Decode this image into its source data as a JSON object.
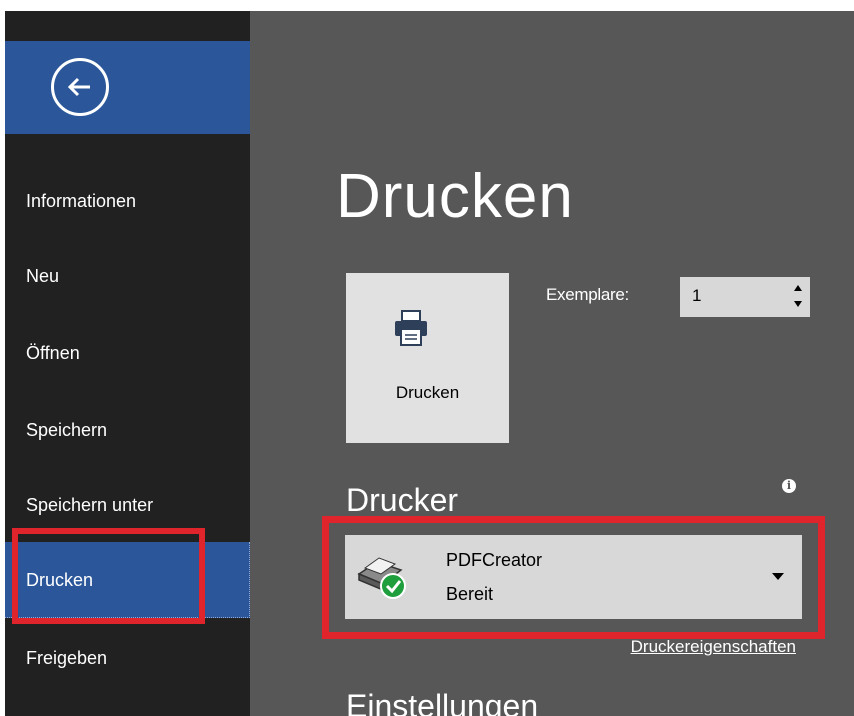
{
  "sidebar": {
    "back_label": "Zurück",
    "items": [
      {
        "label": "Informationen"
      },
      {
        "label": "Neu"
      },
      {
        "label": "Öffnen"
      },
      {
        "label": "Speichern"
      },
      {
        "label": "Speichern unter"
      },
      {
        "label": "Drucken",
        "active": true
      },
      {
        "label": "Freigeben"
      }
    ]
  },
  "main": {
    "title": "Drucken",
    "print_button_label": "Drucken",
    "copies_label": "Exemplare:",
    "copies_value": "1",
    "printer_section_title": "Drucker",
    "printer": {
      "name": "PDFCreator",
      "status": "Bereit"
    },
    "printer_properties_link": "Druckereigenschaften",
    "settings_section_title": "Einstellungen"
  },
  "colors": {
    "sidebar_bg": "#212121",
    "accent": "#2b579a",
    "main_bg": "#575757",
    "highlight": "#e0242c",
    "status_ok": "#1e9e3c"
  },
  "icons": [
    "back-arrow-icon",
    "printer-icon",
    "info-icon",
    "pdfcreator-printer-icon",
    "chevron-down-icon"
  ]
}
